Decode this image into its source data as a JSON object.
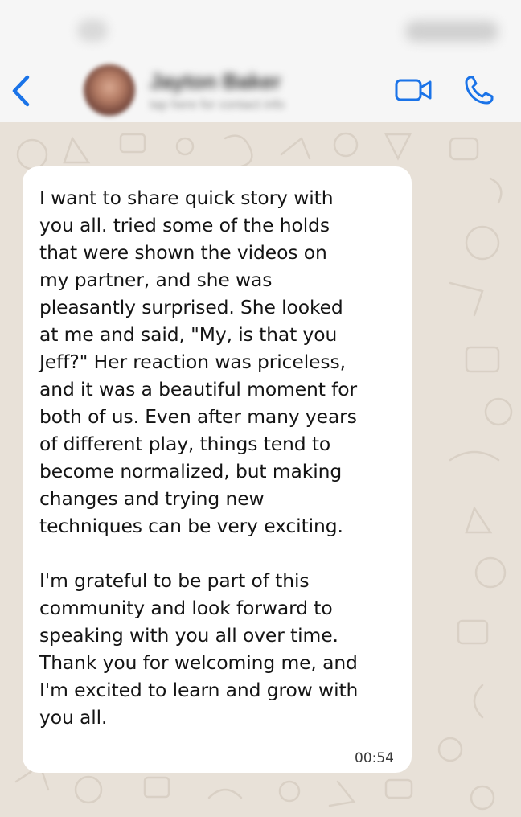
{
  "header": {
    "contact_name": "Jayton Baker",
    "contact_subtitle": "tap here for contact info",
    "icons": {
      "back": "chevron-left-icon",
      "video": "video-camera-icon",
      "phone": "phone-icon"
    }
  },
  "message": {
    "paragraphs": [
      "I want to share quick story with\nyou all. tried some of the holds\nthat were shown the videos on\nmy partner, and she was\npleasantly surprised. She looked\nat me and said, \"My, is that you\nJeff?\" Her reaction was priceless,\nand it was a beautiful moment for\nboth of us. Even after many years\nof different play, things tend to\nbecome normalized, but making\nchanges and trying new\ntechniques can be very exciting.",
      "I'm grateful to be part of this\ncommunity and look forward to\nspeaking with you all over time.\nThank you for welcoming me, and\nI'm excited to learn and grow with\nyou all."
    ],
    "time": "00:54"
  },
  "colors": {
    "accent": "#1a73e8",
    "chat_background": "#e8e1d8",
    "bubble": "#ffffff"
  }
}
